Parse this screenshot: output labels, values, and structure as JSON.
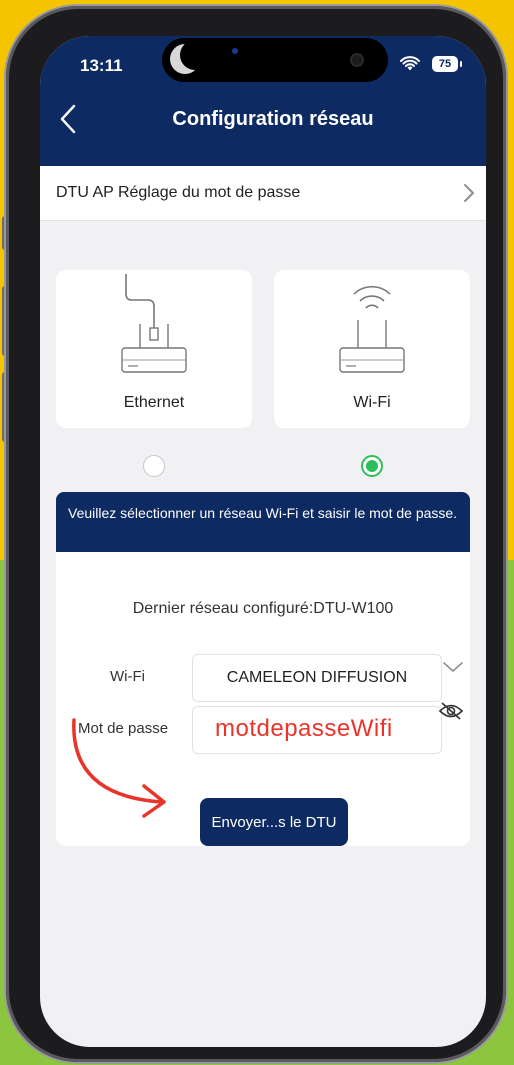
{
  "status_bar": {
    "time": "13:11",
    "battery": "75"
  },
  "header": {
    "title": "Configuration réseau"
  },
  "link_row": {
    "label": "DTU AP Réglage du mot de passe"
  },
  "connection_types": [
    {
      "label": "Ethernet",
      "selected": false
    },
    {
      "label": "Wi-Fi",
      "selected": true
    }
  ],
  "notice": {
    "text": "Veuillez sélectionner un réseau Wi-Fi et saisir le mot de passe."
  },
  "form": {
    "last_network": "Dernier réseau configuré:DTU-W100",
    "wifi_label": "Wi-Fi",
    "wifi_value": "CAMELEON DIFFUSION",
    "password_label": "Mot de passe",
    "password_value": "motdepasseWifi",
    "send_label": "Envoyer...s le DTU"
  },
  "colors": {
    "nav": "#0d2a63",
    "selected": "#2bbf5c",
    "annotation": "#e8342a"
  }
}
